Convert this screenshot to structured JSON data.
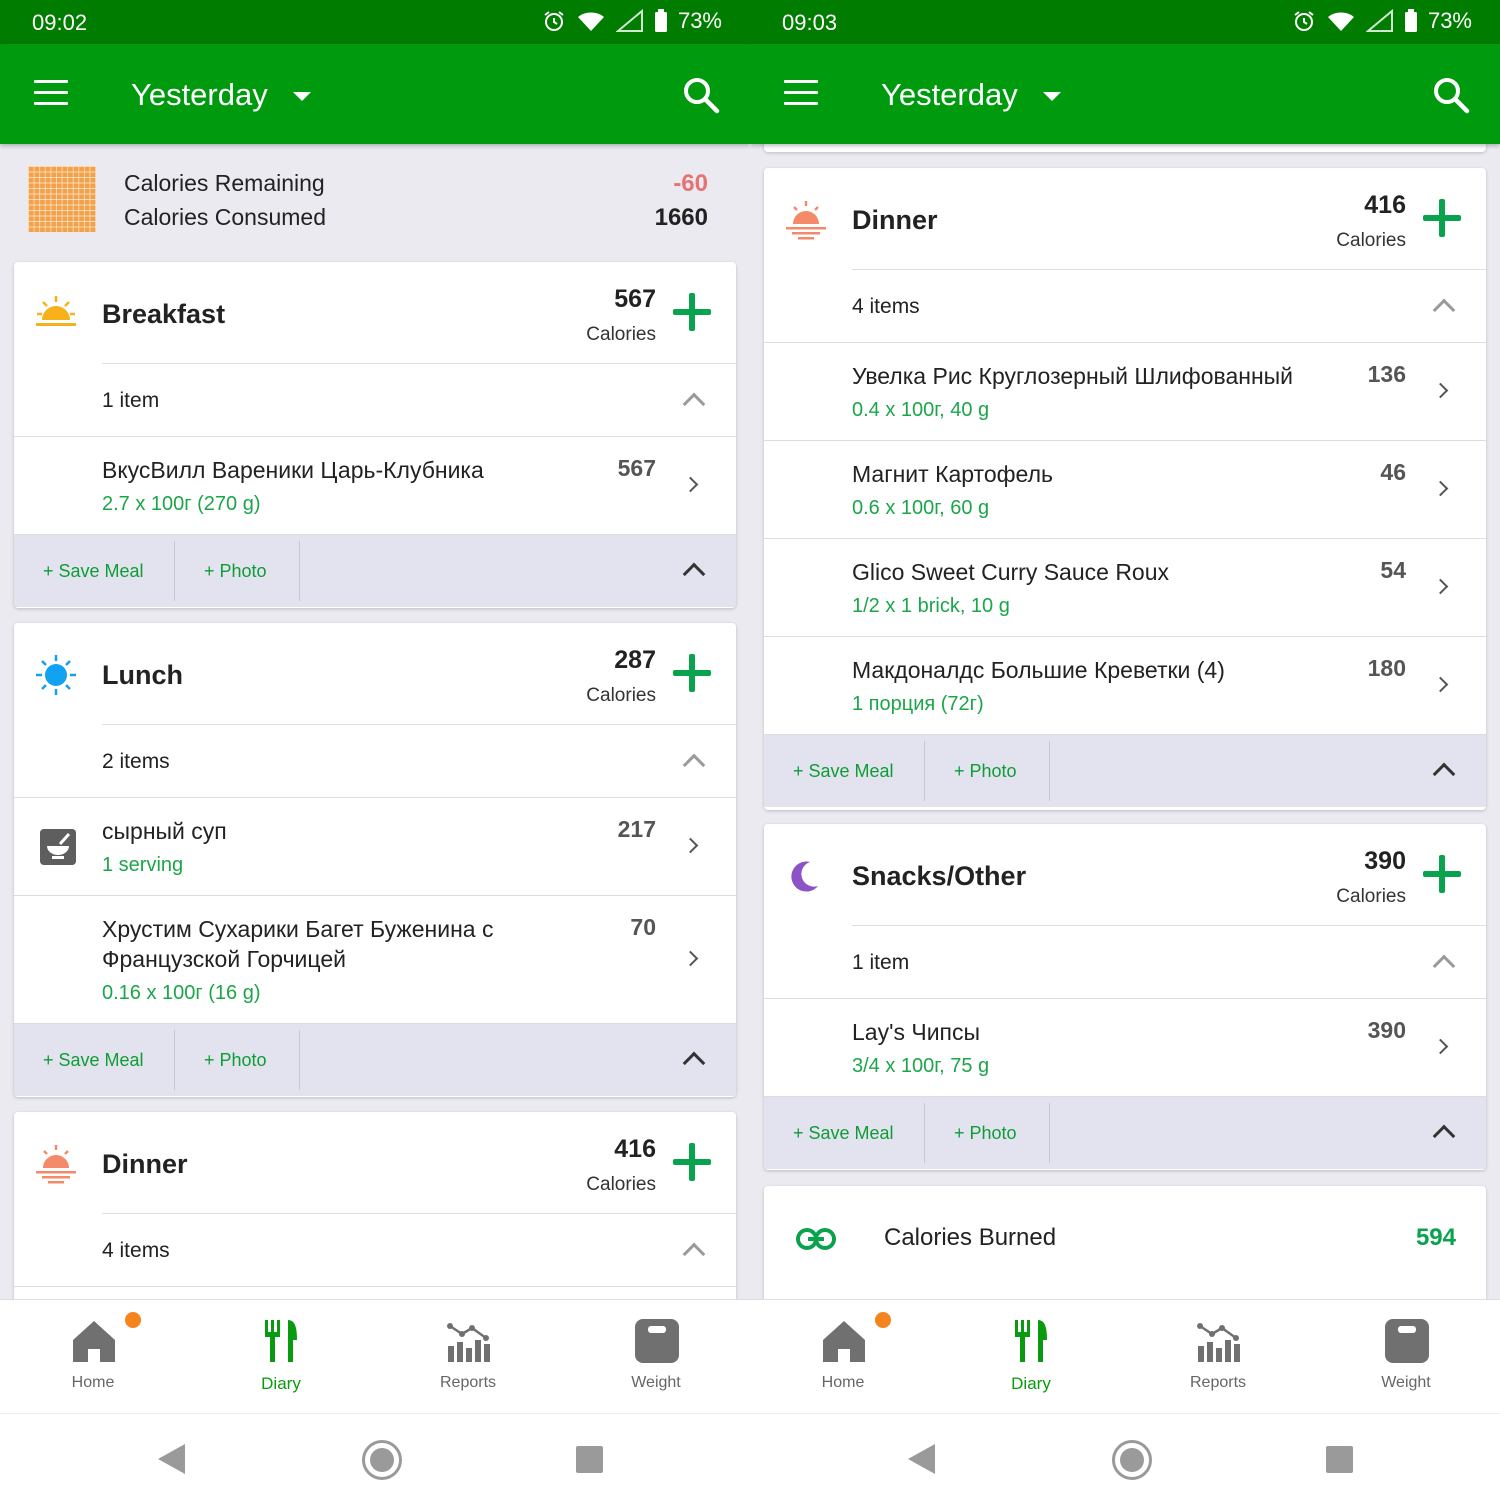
{
  "colors": {
    "status_bar": "#007c00",
    "app_bar": "#009a0f",
    "accent_green": "#0aa34d",
    "negative_red": "#e57373",
    "notification_dot": "#f5841f"
  },
  "left": {
    "status": {
      "time": "09:02",
      "battery": "73%"
    },
    "header": {
      "title": "Yesterday"
    },
    "summary": {
      "remaining_label": "Calories Remaining",
      "remaining_value": "-60",
      "consumed_label": "Calories Consumed",
      "consumed_value": "1660"
    },
    "breakfast": {
      "name": "Breakfast",
      "calories": "567",
      "calories_label": "Calories",
      "count": "1 item",
      "items": [
        {
          "name": "ВкусВилл Вареники Царь-Клубника",
          "serving": "2.7 x 100г (270 g)",
          "calories": "567"
        }
      ],
      "save_meal": "+ Save Meal",
      "photo": "+ Photo"
    },
    "lunch": {
      "name": "Lunch",
      "calories": "287",
      "calories_label": "Calories",
      "count": "2 items",
      "items": [
        {
          "name": "сырный суп",
          "serving": "1 serving",
          "calories": "217"
        },
        {
          "name": "Хрустим Сухарики Багет Буженина с Французской Горчицей",
          "serving": "0.16 x 100г (16 g)",
          "calories": "70"
        }
      ],
      "save_meal": "+ Save Meal",
      "photo": "+ Photo"
    },
    "dinner": {
      "name": "Dinner",
      "calories": "416",
      "calories_label": "Calories",
      "count": "4 items"
    },
    "nav": {
      "home": "Home",
      "diary": "Diary",
      "reports": "Reports",
      "weight": "Weight"
    }
  },
  "right": {
    "status": {
      "time": "09:03",
      "battery": "73%"
    },
    "header": {
      "title": "Yesterday"
    },
    "dinner": {
      "name": "Dinner",
      "calories": "416",
      "calories_label": "Calories",
      "count": "4 items",
      "items": [
        {
          "name": "Увелка Рис Круглозерный Шлифованный",
          "serving": "0.4 x 100г, 40 g",
          "calories": "136"
        },
        {
          "name": "Магнит Картофель",
          "serving": "0.6 x 100г, 60 g",
          "calories": "46"
        },
        {
          "name": "Glico Sweet Curry Sauce Roux",
          "serving": "1/2 x 1 brick, 10 g",
          "calories": "54"
        },
        {
          "name": "Макдоналдс Большие Креветки (4)",
          "serving": "1 порция (72г)",
          "calories": "180"
        }
      ],
      "save_meal": "+ Save Meal",
      "photo": "+ Photo"
    },
    "snacks": {
      "name": "Snacks/Other",
      "calories": "390",
      "calories_label": "Calories",
      "count": "1 item",
      "items": [
        {
          "name": "Lay's Чипсы",
          "serving": "3/4 x 100г, 75 g",
          "calories": "390"
        }
      ],
      "save_meal": "+ Save Meal",
      "photo": "+ Photo"
    },
    "burned": {
      "label": "Calories Burned",
      "value": "594"
    },
    "nav": {
      "home": "Home",
      "diary": "Diary",
      "reports": "Reports",
      "weight": "Weight"
    }
  }
}
